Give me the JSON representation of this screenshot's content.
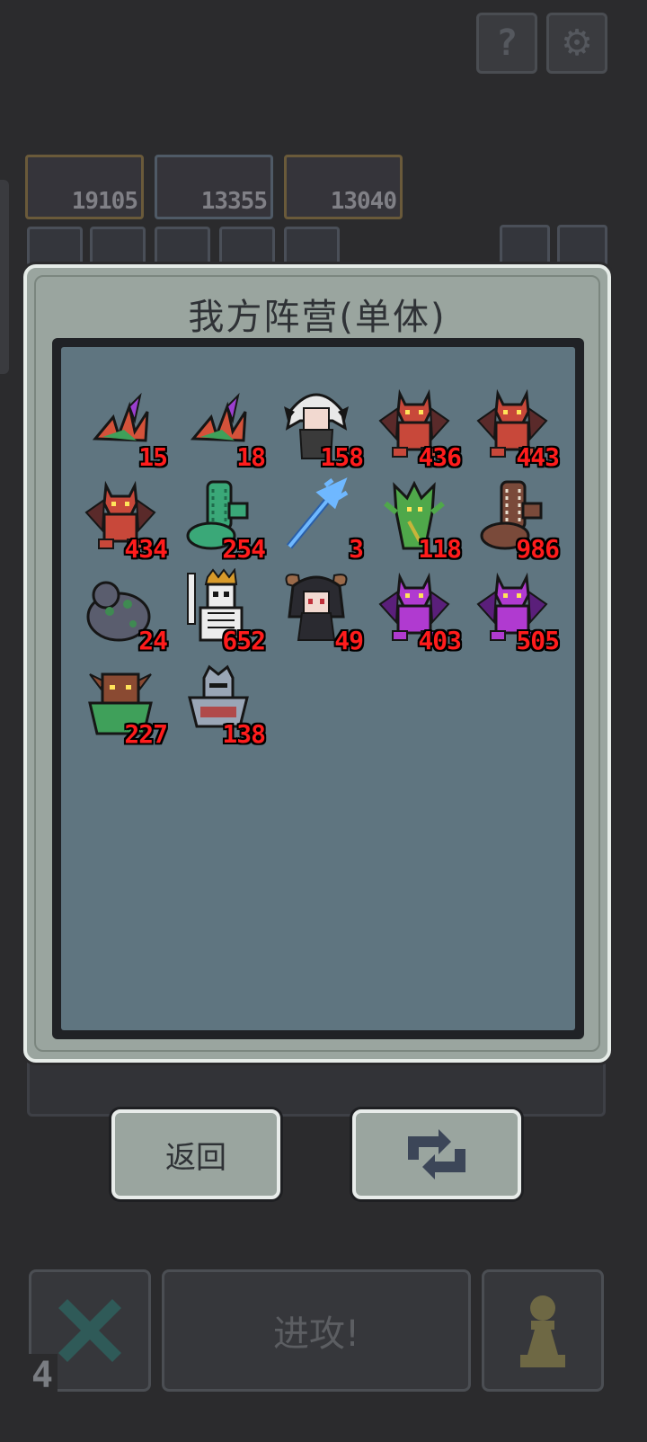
{
  "dialog": {
    "title": "我方阵营(单体)",
    "units": [
      {
        "name": "crystal-plant",
        "count": "15",
        "color": "#d4523a",
        "accent": "#9b3fd0"
      },
      {
        "name": "crystal-plant",
        "count": "18",
        "color": "#d4523a",
        "accent": "#9b3fd0"
      },
      {
        "name": "white-haired-demon-girl",
        "count": "158",
        "color": "#e9e9e9",
        "accent": "#3a3a3a"
      },
      {
        "name": "red-dragon",
        "count": "436",
        "color": "#c8483a",
        "accent": "#5a2a2a"
      },
      {
        "name": "red-dragon",
        "count": "443",
        "color": "#c8483a",
        "accent": "#5a2a2a"
      },
      {
        "name": "red-dragon",
        "count": "434",
        "color": "#c8483a",
        "accent": "#5a2a2a"
      },
      {
        "name": "jade-serpent",
        "count": "254",
        "color": "#3aa878",
        "accent": "#1f6b4c"
      },
      {
        "name": "ice-trident",
        "count": "3",
        "color": "#6fb8ff",
        "accent": "#2a5fa8"
      },
      {
        "name": "forest-treant",
        "count": "118",
        "color": "#4fa84a",
        "accent": "#c8b43a"
      },
      {
        "name": "wooden-serpent",
        "count": "986",
        "color": "#7a4a3a",
        "accent": "#e8e0d0"
      },
      {
        "name": "rock-golem",
        "count": "24",
        "color": "#5a5d6e",
        "accent": "#3f8a52"
      },
      {
        "name": "skeleton-king",
        "count": "652",
        "color": "#ececec",
        "accent": "#d89a2a"
      },
      {
        "name": "horned-dark-girl",
        "count": "49",
        "color": "#2a2a30",
        "accent": "#9a6a4a"
      },
      {
        "name": "purple-dragon",
        "count": "403",
        "color": "#b03ad0",
        "accent": "#5a1f7a"
      },
      {
        "name": "purple-dragon",
        "count": "505",
        "color": "#b03ad0",
        "accent": "#5a1f7a"
      },
      {
        "name": "horned-beast",
        "count": "227",
        "color": "#8a4a32",
        "accent": "#3fa05a"
      },
      {
        "name": "armored-knight",
        "count": "138",
        "color": "#9aa6b6",
        "accent": "#b04a4a"
      }
    ]
  },
  "buttons": {
    "back_label": "返回",
    "refresh_icon": "refresh-icon"
  },
  "background": {
    "top_buttons": [
      "help-icon",
      "settings-icon"
    ],
    "cards": [
      "19105",
      "13355",
      "13040"
    ],
    "attack_label": "进攻!",
    "corner_number": "4"
  },
  "colors": {
    "dialog_bg": "#9aa59f",
    "list_bg": "#5f7580",
    "count": "#ff1c1c"
  }
}
